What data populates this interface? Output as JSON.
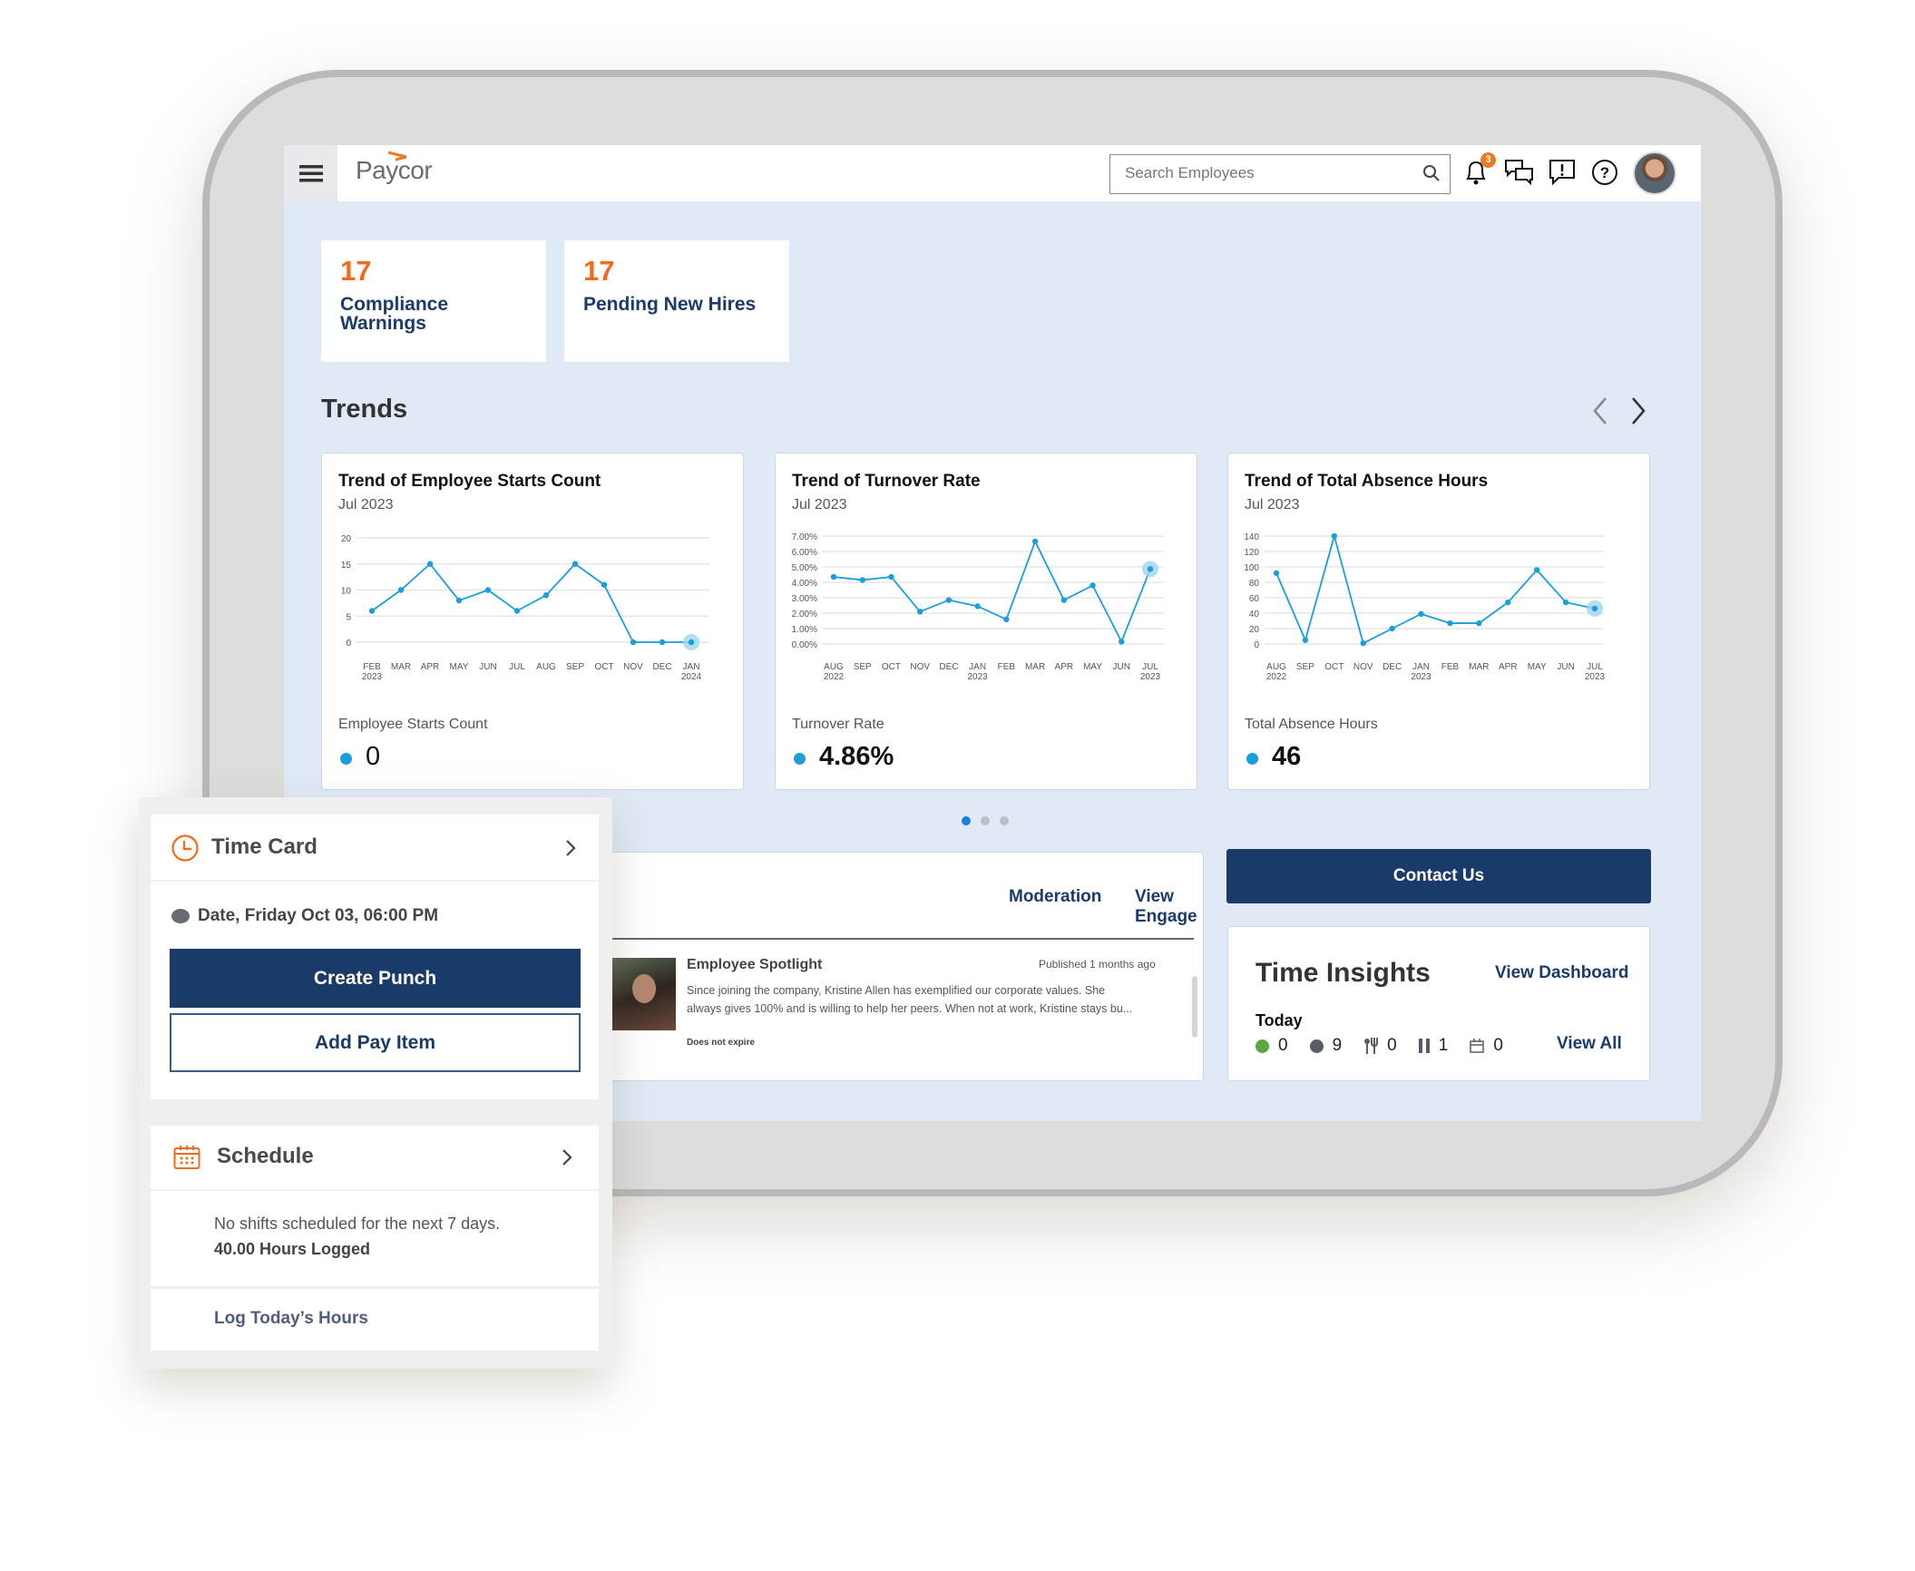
{
  "header": {
    "logo": "Paycor",
    "search_placeholder": "Search Employees",
    "notification_count": "3"
  },
  "kpis": [
    {
      "value": "17",
      "label": "Compliance Warnings"
    },
    {
      "value": "17",
      "label": "Pending New Hires"
    }
  ],
  "trends": {
    "title": "Trends",
    "carousel_pages": 3,
    "active_page": 1
  },
  "chart_data": [
    {
      "type": "line",
      "title": "Trend of Employee Starts Count",
      "subtitle": "Jul 2023",
      "metric_label": "Employee Starts Count",
      "current_value": "0",
      "categories": [
        "FEB 2023",
        "MAR",
        "APR",
        "MAY",
        "JUN",
        "JUL",
        "AUG",
        "SEP",
        "OCT",
        "NOV",
        "DEC",
        "JAN 2024"
      ],
      "values": [
        6,
        10,
        15,
        8,
        10,
        6,
        9,
        15,
        11,
        0,
        0,
        0
      ],
      "ylim": [
        0,
        20
      ],
      "yticks": [
        "0",
        "5",
        "10",
        "15",
        "20"
      ],
      "grid": true,
      "highlight": "last"
    },
    {
      "type": "line",
      "title": "Trend of Turnover Rate",
      "subtitle": "Jul 2023",
      "metric_label": "Turnover Rate",
      "current_value": "4.86%",
      "categories": [
        "AUG 2022",
        "SEP",
        "OCT",
        "NOV",
        "DEC",
        "JAN 2023",
        "FEB",
        "MAR",
        "APR",
        "MAY",
        "JUN",
        "JUL 2023"
      ],
      "values": [
        4.35,
        4.15,
        4.35,
        2.1,
        2.85,
        2.45,
        1.6,
        6.65,
        2.85,
        3.8,
        0.15,
        4.86
      ],
      "ylim": [
        0,
        7
      ],
      "yticks": [
        "0.00%",
        "1.00%",
        "2.00%",
        "3.00%",
        "4.00%",
        "5.00%",
        "6.00%",
        "7.00%"
      ],
      "grid": true,
      "highlight": "last"
    },
    {
      "type": "line",
      "title": "Trend of Total Absence Hours",
      "subtitle": "Jul 2023",
      "metric_label": "Total Absence Hours",
      "current_value": "46",
      "categories": [
        "AUG 2022",
        "SEP",
        "OCT",
        "NOV",
        "DEC",
        "JAN 2023",
        "FEB",
        "MAR",
        "APR",
        "MAY",
        "JUN",
        "JUL 2023"
      ],
      "values": [
        92,
        5,
        140,
        1,
        20,
        39,
        27,
        27,
        54,
        96,
        54,
        46
      ],
      "ylim": [
        0,
        140
      ],
      "yticks": [
        "0",
        "20",
        "40",
        "60",
        "80",
        "100",
        "120",
        "140"
      ],
      "grid": true,
      "highlight": "last"
    }
  ],
  "engage": {
    "moderation": "Moderation",
    "view_engage": "View Engage",
    "post": {
      "title": "Employee Spotlight",
      "published": "Published 1 months ago",
      "body": "Since joining the company, Kristine Allen has exemplified our corporate values. She always gives 100% and is willing to help her peers. When not at work, Kristine stays bu...",
      "expiry": "Does not expire"
    }
  },
  "contact_us": "Contact Us",
  "time_insights": {
    "title": "Time Insights",
    "view_dashboard": "View Dashboard",
    "today": "Today",
    "view_all": "View All",
    "stats": [
      {
        "icon": "clocked-in-dot",
        "value": "0",
        "color": "#5aa744"
      },
      {
        "icon": "clocked-out-dot",
        "value": "9",
        "color": "#555d69"
      },
      {
        "icon": "meal-icon",
        "value": "0"
      },
      {
        "icon": "break-icon",
        "value": "1"
      },
      {
        "icon": "calendar-icon",
        "value": "0"
      }
    ]
  },
  "time_card": {
    "title": "Time Card",
    "date": "Date, Friday Oct 03, 06:00 PM",
    "create_punch": "Create Punch",
    "add_pay_item": "Add Pay Item"
  },
  "schedule": {
    "title": "Schedule",
    "no_shifts": "No shifts scheduled for the next 7 days.",
    "hours_logged": "40.00 Hours Logged",
    "log_hours": "Log Today’s Hours"
  },
  "colors": {
    "accent": "#f26b1d",
    "navy": "#1a3a69",
    "chart_line": "#1a9fdc",
    "screen_bg": "#dfeaf6"
  }
}
